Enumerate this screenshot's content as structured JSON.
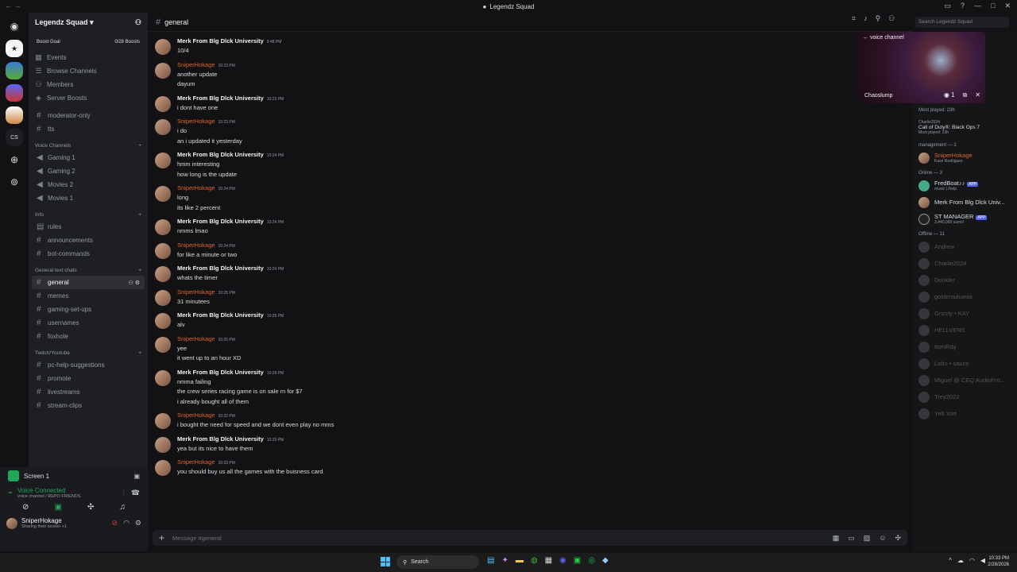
{
  "window": {
    "title": "Legendz Squad"
  },
  "server": {
    "name": "Legendz Squad",
    "boost_goal": "Boost Goal",
    "boost_count": "0/28 Boosts"
  },
  "nav": [
    "Events",
    "Browse Channels",
    "Members",
    "Server Boosts"
  ],
  "channels_top": [
    "moderator-only",
    "tts"
  ],
  "voice_category": "Voice Channels",
  "voice_channels": [
    "Gaming 1",
    "Gaming 2",
    "Movies 2",
    "Movies 1"
  ],
  "info_category": "Info",
  "info_channels": [
    "rules",
    "announcements",
    "bot-commands"
  ],
  "general_category": "General text chats",
  "general_channels": [
    "general",
    "memes",
    "gaming-set-ups",
    "usernames",
    "foxhole"
  ],
  "twitch_category": "Twitch/Youtube",
  "twitch_channels": [
    "pc-help-suggestions",
    "promote",
    "livestreams",
    "stream-clips"
  ],
  "voice_panel": {
    "screen": "Screen 1",
    "status": "Voice Connected",
    "location": "voice channel / REPO FRIENDS"
  },
  "me": {
    "name": "SniperHokage",
    "status": "Sharing their screen +1"
  },
  "chat": {
    "channel": "general",
    "placeholder": "Message #general",
    "search_placeholder": "Search Legendz Squad"
  },
  "messages": [
    {
      "author": "Merk From Blg Dlck University",
      "sniper": false,
      "time": "9:48 PM",
      "lines": [
        "10/4"
      ]
    },
    {
      "author": "SniperHokage",
      "sniper": true,
      "time": "10:23 PM",
      "lines": [
        "another update",
        "dayum"
      ]
    },
    {
      "author": "Merk From Blg Dlck University",
      "sniper": false,
      "time": "10:23 PM",
      "lines": [
        "i dont have one"
      ]
    },
    {
      "author": "SniperHokage",
      "sniper": true,
      "time": "10:23 PM",
      "lines": [
        "i do",
        "an i updated it yesterday"
      ]
    },
    {
      "author": "Merk From Blg Dlck University",
      "sniper": false,
      "time": "10:24 PM",
      "lines": [
        "hmm interesting",
        "how long is the update"
      ]
    },
    {
      "author": "SniperHokage",
      "sniper": true,
      "time": "10:24 PM",
      "lines": [
        "long",
        "its like 2 percent"
      ]
    },
    {
      "author": "Merk From Blg Dlck University",
      "sniper": false,
      "time": "10:24 PM",
      "lines": [
        "nmms lmao"
      ]
    },
    {
      "author": "SniperHokage",
      "sniper": true,
      "time": "10:24 PM",
      "lines": [
        "for like a minute or two"
      ]
    },
    {
      "author": "Merk From Blg Dlck University",
      "sniper": false,
      "time": "10:24 PM",
      "lines": [
        "whats the timer"
      ]
    },
    {
      "author": "SniperHokage",
      "sniper": true,
      "time": "10:25 PM",
      "lines": [
        "31 minutees"
      ]
    },
    {
      "author": "Merk From Blg Dlck University",
      "sniper": false,
      "time": "10:25 PM",
      "lines": [
        "alv"
      ]
    },
    {
      "author": "SniperHokage",
      "sniper": true,
      "time": "10:25 PM",
      "lines": [
        "yee",
        "it went up to an hour XD"
      ]
    },
    {
      "author": "Merk From Blg Dlck University",
      "sniper": false,
      "time": "10:29 PM",
      "lines": [
        "nmma failing",
        "the crew series racing game is on sale rn for $7",
        "i already bought all of them"
      ]
    },
    {
      "author": "SniperHokage",
      "sniper": true,
      "time": "10:32 PM",
      "lines": [
        "i bought the need for speed and we dont even play no mms"
      ]
    },
    {
      "author": "Merk From Blg Dlck University",
      "sniper": false,
      "time": "10:33 PM",
      "lines": [
        "yea but its nice to have them"
      ]
    },
    {
      "author": "SniperHokage",
      "sniper": true,
      "time": "10:33 PM",
      "lines": [
        "you should buy us all the games with the buisness card"
      ]
    }
  ],
  "pip": {
    "title": "voice channel",
    "streamer": "Chaoslump",
    "viewers": "1"
  },
  "members": {
    "top_activity": "Most played: 23h",
    "charlie": {
      "name": "Charlie2024",
      "game": "Call of Duty®: Black Ops 7",
      "played": "Most played: 23h"
    },
    "management_header": "management — 1",
    "management": [
      {
        "name": "SniperHokage",
        "sub": "Kase Rodriguez"
      }
    ],
    "online_header": "Online — 3",
    "online": [
      {
        "name": "FredBoat♪♪",
        "sub": "music | /help",
        "app": "APP"
      },
      {
        "name": "Merk From Blg Dlck Univ...",
        "sub": "",
        "app": ""
      },
      {
        "name": "ST MANAGER",
        "sub": "3,440,089 users!",
        "app": "APP"
      }
    ],
    "offline_header": "Offline — 11",
    "offline": [
      "Andrew",
      "Charlie2024",
      "Donkler",
      "goldentuluwak",
      "Grizzly • KAY",
      "HELLVENS",
      "ItsmRdy",
      "Lobo • sauce",
      "Miguel @ CEQ AudioPro...",
      "Trey2022",
      "Yeb Yort"
    ]
  },
  "taskbar": {
    "search": "Search",
    "time": "10:33 PM",
    "date": "2/28/2026"
  }
}
